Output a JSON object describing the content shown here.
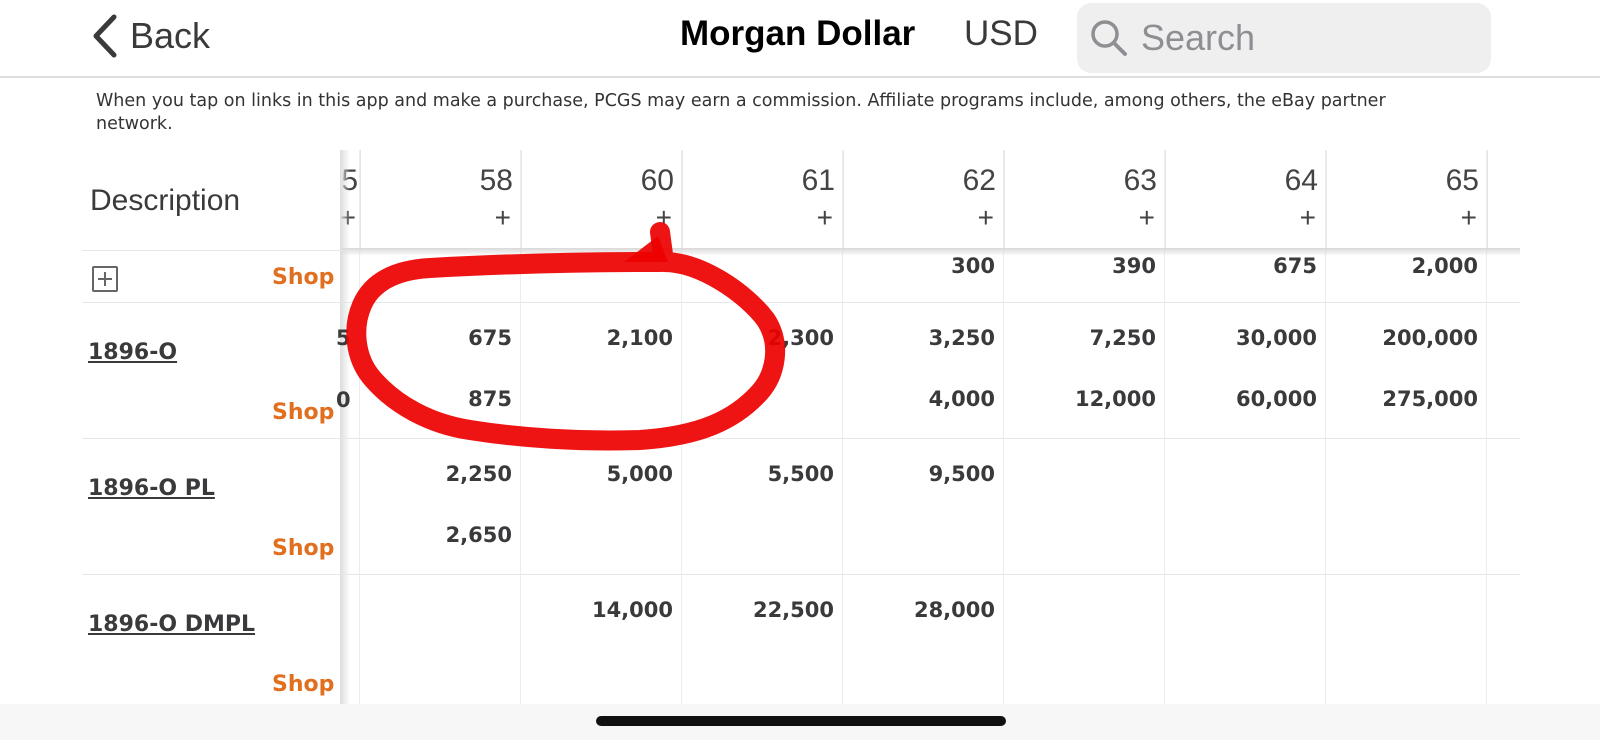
{
  "nav": {
    "back_label": "Back",
    "title": "Morgan Dollar",
    "currency": "USD",
    "search_placeholder": "Search"
  },
  "disclaimer": "When you tap on links in this app and make a purchase, PCGS may earn a commission. Affiliate programs include, among others, the eBay partner network.",
  "table": {
    "description_header": "Description",
    "partial_grade": "5",
    "grades": [
      "58",
      "60",
      "61",
      "62",
      "63",
      "64",
      "65"
    ],
    "plus_label": "+",
    "shop_label": "Shop",
    "top_row": [
      "",
      "",
      "",
      "300",
      "390",
      "675",
      "2,000"
    ],
    "rows": [
      {
        "name": "1896-O",
        "partial_prices": [
          "5",
          "0"
        ],
        "price_rows": [
          [
            "675",
            "2,100",
            "2,300",
            "3,250",
            "7,250",
            "30,000",
            "200,000"
          ],
          [
            "875",
            "",
            "",
            "4,000",
            "12,000",
            "60,000",
            "275,000"
          ]
        ]
      },
      {
        "name": "1896-O PL",
        "partial_prices": [
          "",
          ""
        ],
        "price_rows": [
          [
            "2,250",
            "5,000",
            "5,500",
            "9,500",
            "",
            "",
            ""
          ],
          [
            "2,650",
            "",
            "",
            "",
            "",
            "",
            ""
          ]
        ]
      },
      {
        "name": "1896-O DMPL",
        "partial_prices": [
          "",
          ""
        ],
        "price_rows": [
          [
            "",
            "14,000",
            "22,500",
            "28,000",
            "",
            "",
            ""
          ],
          [
            "",
            "",
            "",
            "",
            "",
            "",
            ""
          ]
        ]
      }
    ]
  },
  "annotation": {
    "color": "#ee0000"
  }
}
